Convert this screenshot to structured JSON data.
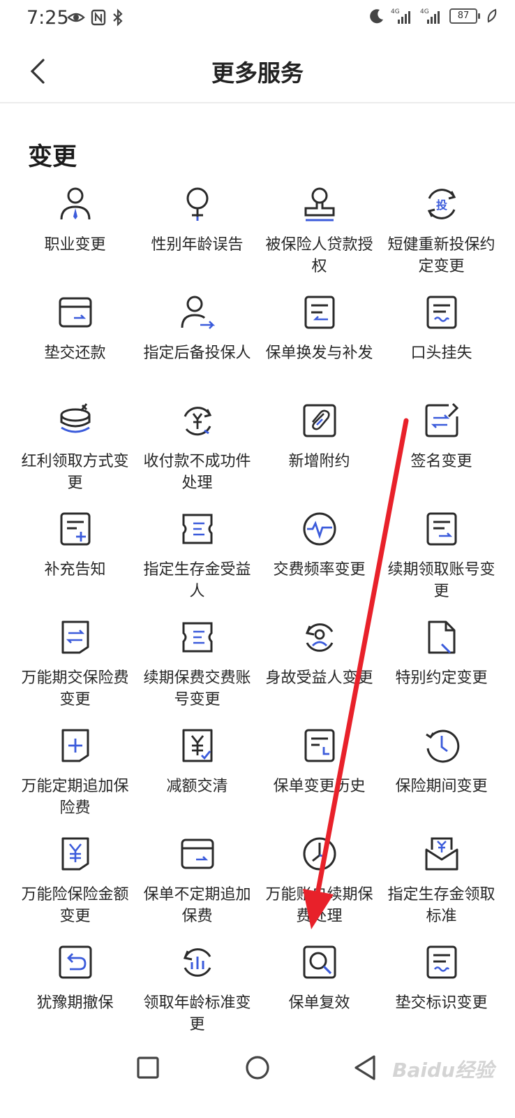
{
  "status_bar": {
    "time": "7:25",
    "battery": "87",
    "signal_1": "4G",
    "signal_2": "4G"
  },
  "header": {
    "title": "更多服务"
  },
  "section": {
    "title": "变更"
  },
  "colors": {
    "icon_dark": "#2a2a2a",
    "icon_accent": "#3b5bdb",
    "arrow_red": "#e8212a"
  },
  "services": [
    {
      "label": "职业变更",
      "icon": "user-tie-icon"
    },
    {
      "label": "性别年龄误告",
      "icon": "gender-icon"
    },
    {
      "label": "被保险人贷款授权",
      "icon": "stamp-icon"
    },
    {
      "label": "短健重新投保约定变更",
      "icon": "refresh-tou-icon"
    },
    {
      "label": "垫交还款",
      "icon": "card-arrow-icon"
    },
    {
      "label": "指定后备投保人",
      "icon": "user-arrow-icon"
    },
    {
      "label": "保单换发与补发",
      "icon": "doc-exchange-icon"
    },
    {
      "label": "口头挂失",
      "icon": "doc-wave-icon"
    },
    {
      "label": "红利领取方式变更",
      "icon": "coins-icon"
    },
    {
      "label": "收付款不成功件处理",
      "icon": "yuan-refresh-icon"
    },
    {
      "label": "新增附约",
      "icon": "paperclip-icon"
    },
    {
      "label": "签名变更",
      "icon": "doc-sign-icon"
    },
    {
      "label": "补充告知",
      "icon": "doc-plus-icon"
    },
    {
      "label": "指定生存金受益人",
      "icon": "ticket-icon"
    },
    {
      "label": "交费频率变更",
      "icon": "pulse-icon"
    },
    {
      "label": "续期领取账号变更",
      "icon": "doc-lines-icon"
    },
    {
      "label": "万能期交保险费变更",
      "icon": "shield-exchange-icon"
    },
    {
      "label": "续期保费交费账号变更",
      "icon": "ticket-2-icon"
    },
    {
      "label": "身故受益人变更",
      "icon": "user-refresh-icon"
    },
    {
      "label": "特别约定变更",
      "icon": "page-pen-icon"
    },
    {
      "label": "万能定期追加保险费",
      "icon": "shield-plus-icon"
    },
    {
      "label": "减额交清",
      "icon": "yuan-check-icon"
    },
    {
      "label": "保单变更历史",
      "icon": "doc-history-icon"
    },
    {
      "label": "保险期间变更",
      "icon": "clock-refresh-icon"
    },
    {
      "label": "万能险保险金额变更",
      "icon": "shield-yuan-icon"
    },
    {
      "label": "保单不定期追加保费",
      "icon": "card-arrow-2-icon"
    },
    {
      "label": "万能账户续期保费处理",
      "icon": "clock-icon"
    },
    {
      "label": "指定生存金领取标准",
      "icon": "envelope-yuan-icon"
    },
    {
      "label": "犹豫期撤保",
      "icon": "undo-box-icon"
    },
    {
      "label": "领取年龄标准变更",
      "icon": "chart-refresh-icon"
    },
    {
      "label": "保单复效",
      "icon": "search-box-icon"
    },
    {
      "label": "垫交标识变更",
      "icon": "doc-wave-2-icon"
    }
  ],
  "bottom_nav": {
    "recent": "square-icon",
    "home": "circle-icon",
    "back": "triangle-back-icon"
  },
  "watermark": "Baidu经验"
}
